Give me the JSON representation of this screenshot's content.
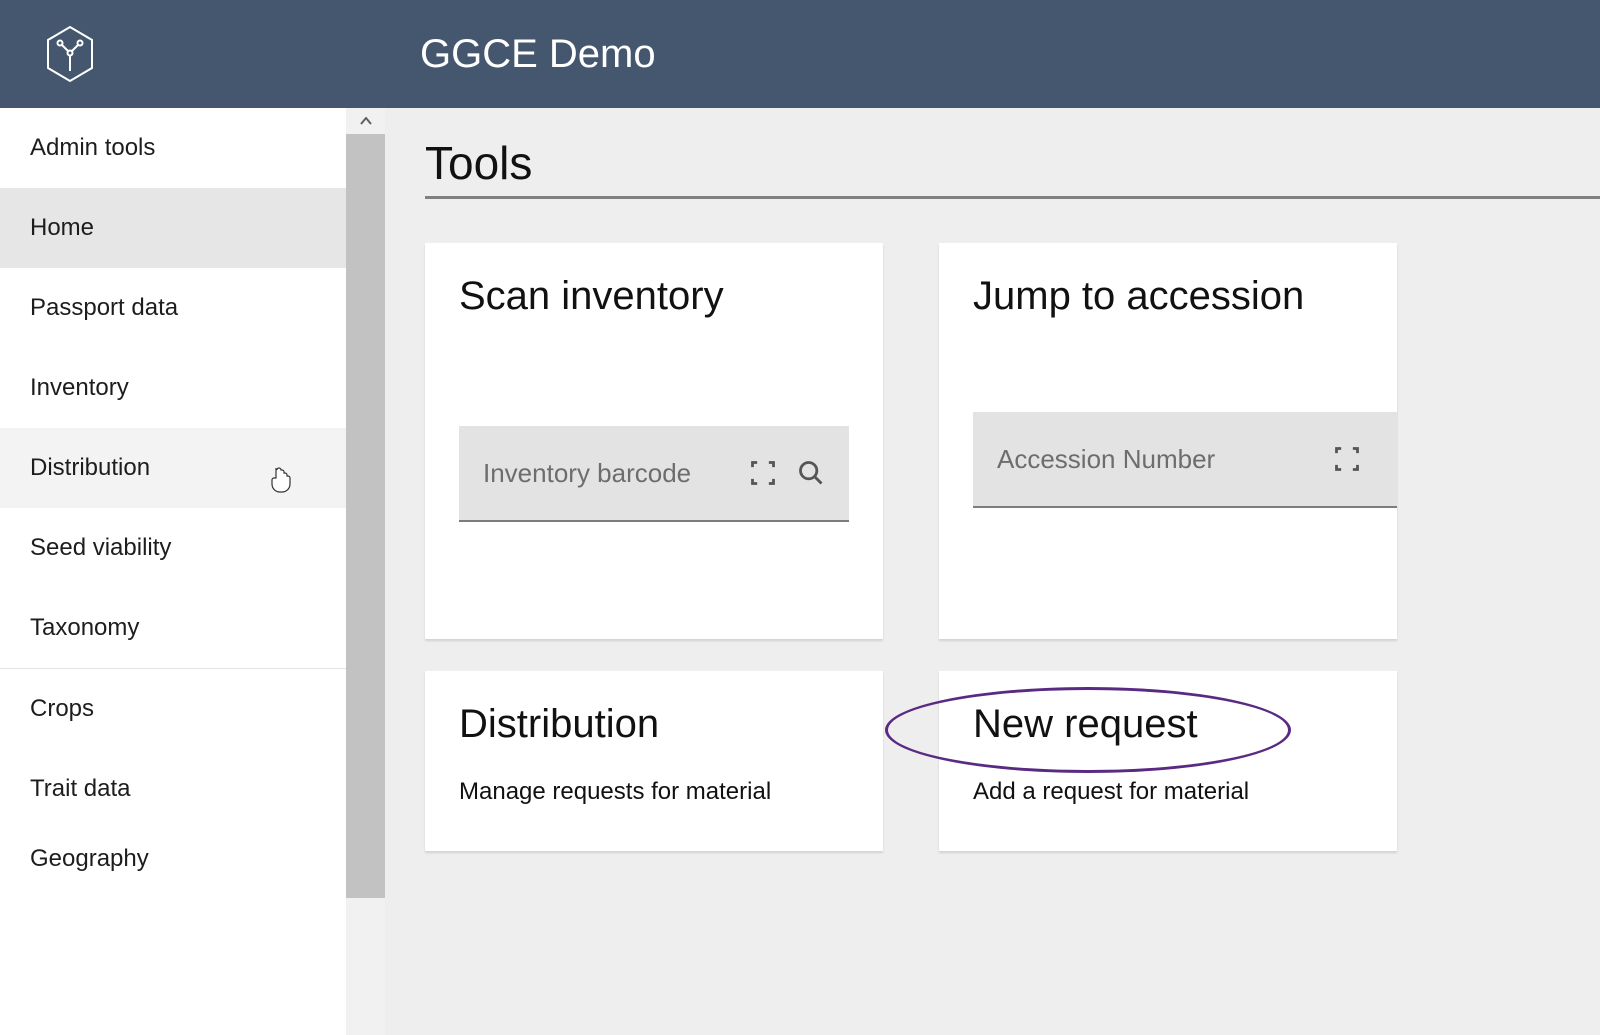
{
  "header": {
    "title": "GGCE Demo"
  },
  "sidebar": {
    "items": [
      {
        "label": "Admin tools"
      },
      {
        "label": "Home"
      },
      {
        "label": "Passport data"
      },
      {
        "label": "Inventory"
      },
      {
        "label": "Distribution"
      },
      {
        "label": "Seed viability"
      },
      {
        "label": "Taxonomy"
      },
      {
        "label": "Crops"
      },
      {
        "label": "Trait data"
      },
      {
        "label": "Geography"
      }
    ],
    "selected_index": 1,
    "hovered_index": 4
  },
  "main": {
    "title": "Tools",
    "cards": {
      "scan_inventory": {
        "title": "Scan inventory",
        "placeholder": "Inventory barcode"
      },
      "jump_accession": {
        "title": "Jump to accession",
        "placeholder": "Accession Number"
      },
      "distribution": {
        "title": "Distribution",
        "subtitle": "Manage requests for material"
      },
      "new_request": {
        "title": "New request",
        "subtitle": "Add a request for material"
      }
    }
  }
}
